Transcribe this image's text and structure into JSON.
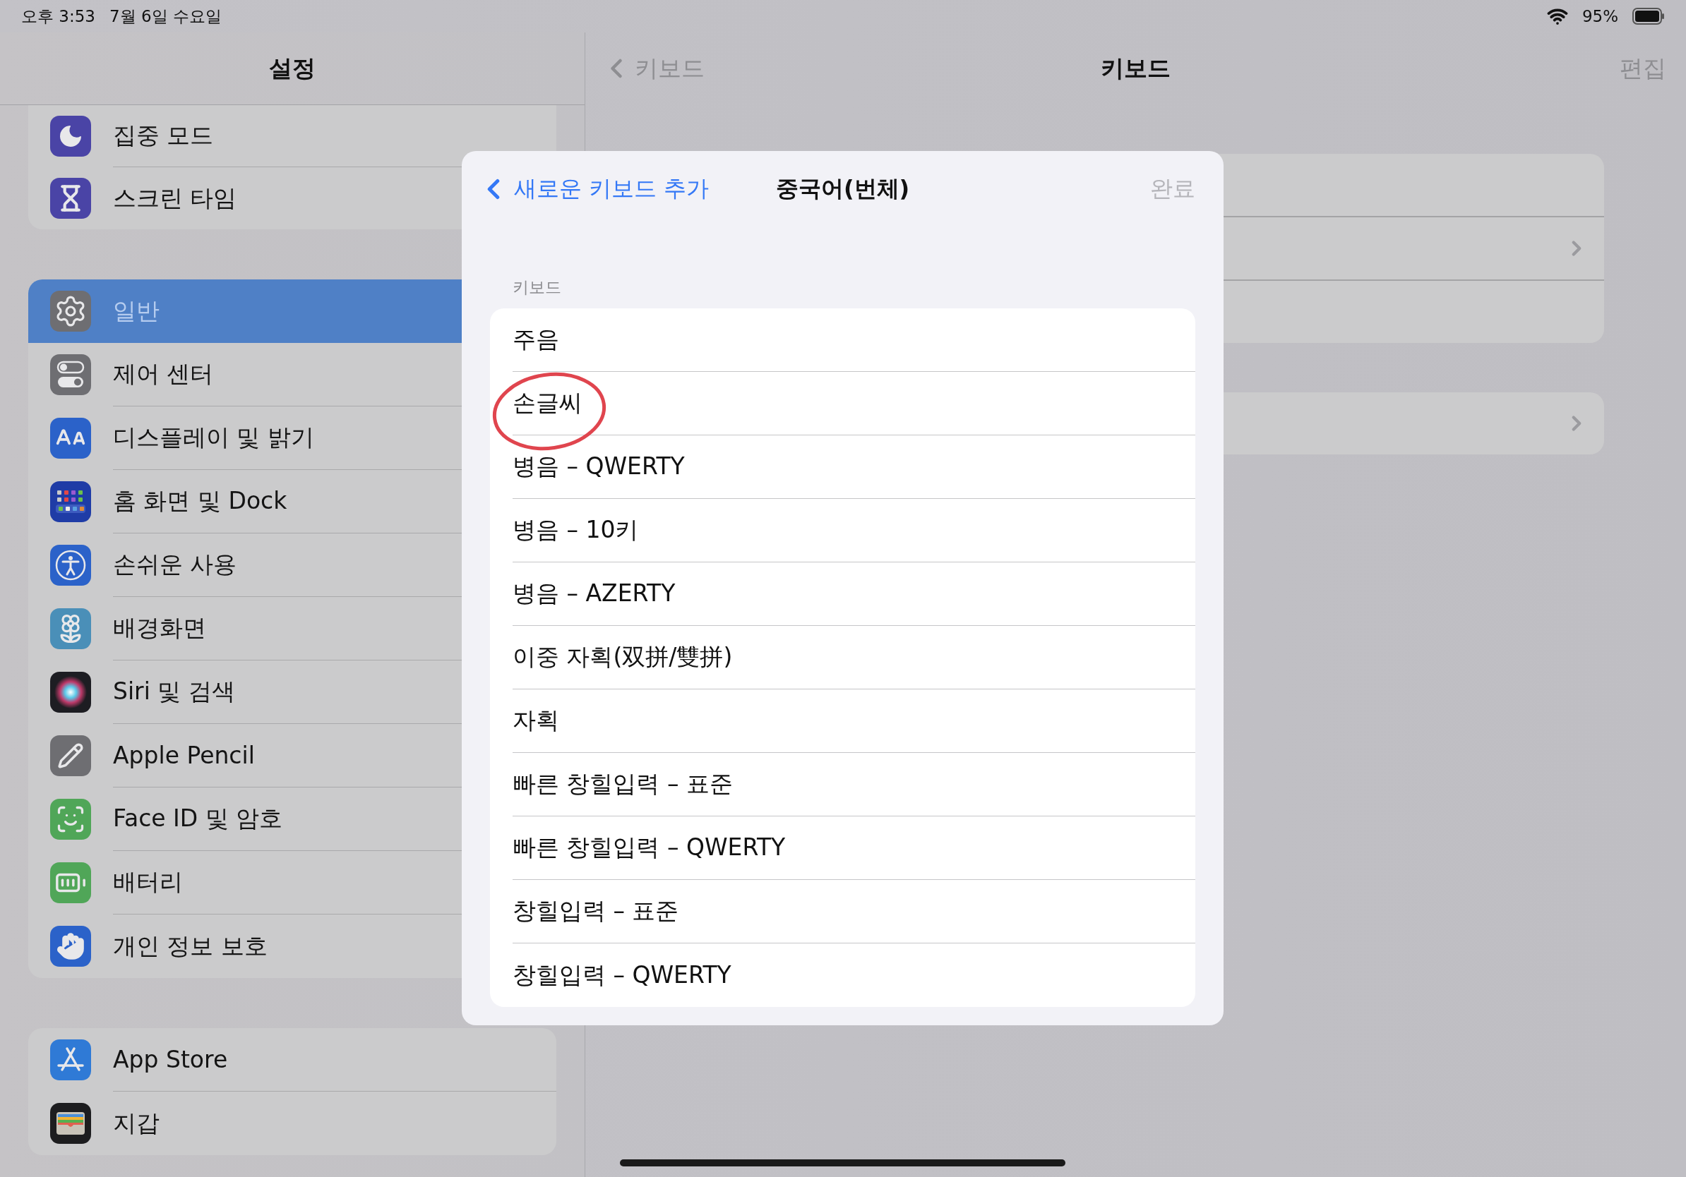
{
  "status_bar": {
    "time": "오후 3:53",
    "date": "7월 6일 수요일",
    "battery": "95%"
  },
  "sidebar": {
    "title": "설정",
    "groups": [
      {
        "items": [
          {
            "label": "집중 모드",
            "kind": "focus",
            "color": "#4a44a6",
            "selected": false
          },
          {
            "label": "스크린 타임",
            "kind": "screentime",
            "color": "#4a44a6",
            "selected": false
          }
        ]
      },
      {
        "items": [
          {
            "label": "일반",
            "kind": "general",
            "color": "#6e6e72",
            "selected": true
          },
          {
            "label": "제어 센터",
            "kind": "control",
            "color": "#6e6e72",
            "selected": false
          },
          {
            "label": "디스플레이 및 밝기",
            "kind": "display",
            "color": "#2b62c9",
            "selected": false
          },
          {
            "label": "홈 화면 및 Dock",
            "kind": "home",
            "color": "#1f3ca6",
            "selected": false
          },
          {
            "label": "손쉬운 사용",
            "kind": "accessibility",
            "color": "#2b62c9",
            "selected": false
          },
          {
            "label": "배경화면",
            "kind": "wallpaper",
            "color": "#4a8fb8",
            "selected": false
          },
          {
            "label": "Siri 및 검색",
            "kind": "siri",
            "color": "#1d1d22",
            "selected": false
          },
          {
            "label": "Apple Pencil",
            "kind": "pencil",
            "color": "#6e6e72",
            "selected": false
          },
          {
            "label": "Face ID 및 암호",
            "kind": "faceid",
            "color": "#50a658",
            "selected": false
          },
          {
            "label": "배터리",
            "kind": "battery",
            "color": "#50a658",
            "selected": false
          },
          {
            "label": "개인 정보 보호",
            "kind": "privacy",
            "color": "#2b62c9",
            "selected": false
          }
        ]
      },
      {
        "items": [
          {
            "label": "App Store",
            "kind": "appstore",
            "color": "#2f7ad6",
            "selected": false
          },
          {
            "label": "지갑",
            "kind": "wallet",
            "color": "#1d1d1f",
            "selected": false
          }
        ]
      }
    ]
  },
  "detail": {
    "back": "키보드",
    "title": "키보드",
    "edit": "편집",
    "groups": [
      {
        "rows": [
          {
            "chevron": false
          },
          {
            "chevron": true
          },
          {
            "chevron": false
          }
        ]
      },
      {
        "rows": [
          {
            "chevron": true
          }
        ]
      }
    ]
  },
  "modal": {
    "back": "새로운 키보드 추가",
    "title": "중국어(번체)",
    "done": "완료",
    "done_disabled": true,
    "section": "키보드",
    "keyboards": [
      {
        "label": "주음",
        "circled": false
      },
      {
        "label": "손글씨",
        "circled": true
      },
      {
        "label": "병음 – QWERTY",
        "circled": false
      },
      {
        "label": "병음 – 10키",
        "circled": false
      },
      {
        "label": "병음 – AZERTY",
        "circled": false
      },
      {
        "label": "이중 자획(双拼/雙拼)",
        "circled": false
      },
      {
        "label": "자획",
        "circled": false
      },
      {
        "label": "빠른 창힐입력 – 표준",
        "circled": false
      },
      {
        "label": "빠른 창힐입력 – QWERTY",
        "circled": false
      },
      {
        "label": "창힐입력 – 표준",
        "circled": false
      },
      {
        "label": "창힐입력 – QWERTY",
        "circled": false
      }
    ]
  }
}
